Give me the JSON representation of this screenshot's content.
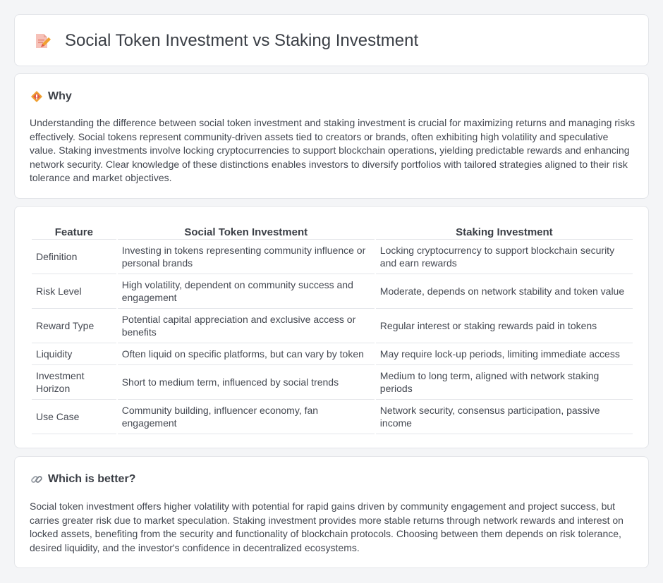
{
  "header": {
    "title": "Social Token Investment vs Staking Investment",
    "icon": "document-pencil-icon"
  },
  "why": {
    "icon": "diamond-sign-icon",
    "heading": "Why",
    "body": "Understanding the difference between social token investment and staking investment is crucial for maximizing returns and managing risks effectively. Social tokens represent community-driven assets tied to creators or brands, often exhibiting high volatility and speculative value. Staking investments involve locking cryptocurrencies to support blockchain operations, yielding predictable rewards and enhancing network security. Clear knowledge of these distinctions enables investors to diversify portfolios with tailored strategies aligned to their risk tolerance and market objectives."
  },
  "comparison": {
    "headers": [
      "Feature",
      "Social Token Investment",
      "Staking Investment"
    ],
    "rows": [
      [
        "Definition",
        "Investing in tokens representing community influence or personal brands",
        "Locking cryptocurrency to support blockchain security and earn rewards"
      ],
      [
        "Risk Level",
        "High volatility, dependent on community success and engagement",
        "Moderate, depends on network stability and token value"
      ],
      [
        "Reward Type",
        "Potential capital appreciation and exclusive access or benefits",
        "Regular interest or staking rewards paid in tokens"
      ],
      [
        "Liquidity",
        "Often liquid on specific platforms, but can vary by token",
        "May require lock-up periods, limiting immediate access"
      ],
      [
        "Investment Horizon",
        "Short to medium term, influenced by social trends",
        "Medium to long term, aligned with network staking periods"
      ],
      [
        "Use Case",
        "Community building, influencer economy, fan engagement",
        "Network security, consensus participation, passive income"
      ]
    ]
  },
  "better": {
    "icon": "link-icon",
    "heading": "Which is better?",
    "body": "Social token investment offers higher volatility with potential for rapid gains driven by community engagement and project success, but carries greater risk due to market speculation. Staking investment provides more stable returns through network rewards and interest on locked assets, benefiting from the security and functionality of blockchain protocols. Choosing between them depends on risk tolerance, desired liquidity, and the investor's confidence in decentralized ecosystems."
  },
  "colors": {
    "background": "#f4f5f7",
    "card": "#ffffff",
    "border": "#e3e5e9",
    "accent_orange": "#f0a030",
    "accent_red": "#e05a4a"
  }
}
